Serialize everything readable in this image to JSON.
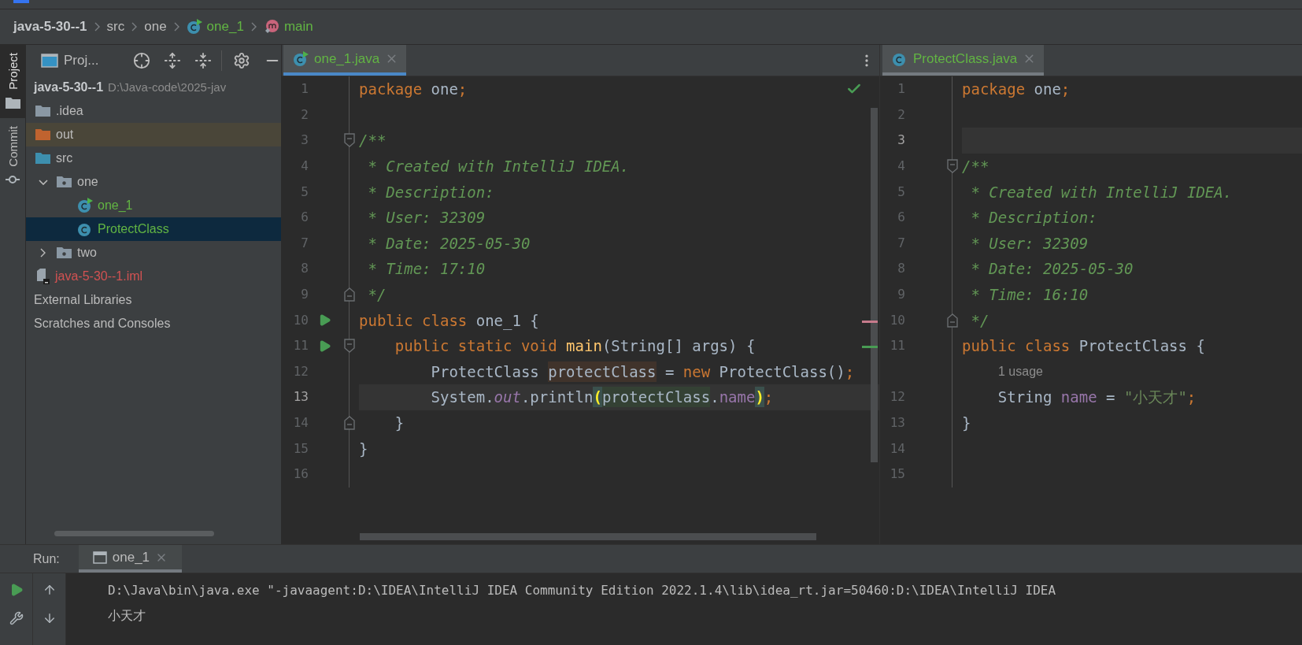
{
  "breadcrumb": [
    {
      "label": "java-5-30--1",
      "kind": "module"
    },
    {
      "label": "src",
      "kind": "folder"
    },
    {
      "label": "one",
      "kind": "folder"
    },
    {
      "label": "one_1",
      "kind": "runnable-class",
      "color": "#62b543"
    },
    {
      "label": "main",
      "kind": "method",
      "color": "#62b543"
    }
  ],
  "side_tabs": [
    {
      "label": "Project",
      "kind": "project",
      "selected": true
    },
    {
      "label": "Commit",
      "kind": "commit",
      "selected": false
    }
  ],
  "project_panel": {
    "title": "Proj...",
    "tree": [
      {
        "label": "java-5-30--1",
        "path": "D:\\Java-code\\2025-jav",
        "kind": "module",
        "selected": false,
        "children": [
          {
            "label": ".idea",
            "kind": "folder",
            "selected": false
          },
          {
            "label": "out",
            "kind": "excluded-folder",
            "selected": false
          },
          {
            "label": "src",
            "kind": "source-folder",
            "selected": false,
            "children": [
              {
                "label": "one",
                "kind": "package",
                "expanded": true,
                "selected": false,
                "children": [
                  {
                    "label": "one_1",
                    "kind": "runnable-class",
                    "color": "#62b543",
                    "selected": false
                  },
                  {
                    "label": "ProtectClass",
                    "kind": "class",
                    "color": "#62b543",
                    "selected": true
                  }
                ]
              },
              {
                "label": "two",
                "kind": "package",
                "expanded": false,
                "selected": false
              }
            ]
          },
          {
            "label": "java-5-30--1.iml",
            "kind": "module-file",
            "color": "#d25252",
            "selected": false
          }
        ]
      },
      {
        "label": "External Libraries",
        "kind": "libraries",
        "selected": false
      },
      {
        "label": "Scratches and Consoles",
        "kind": "scratches",
        "selected": false
      }
    ]
  },
  "editors": [
    {
      "tab": {
        "label": "one_1.java",
        "kind": "runnable-class",
        "color": "#62b543",
        "selected": true
      },
      "focused": true,
      "more_menu": true,
      "inspection_ok": true,
      "lines": [
        {
          "n": "1",
          "current": false,
          "tokens": [
            {
              "kind": "kw",
              "text": "package"
            },
            {
              "kind": "plain",
              "text": " one"
            },
            {
              "kind": "semi",
              "text": ";"
            }
          ]
        },
        {
          "n": "2",
          "current": false
        },
        {
          "n": "3",
          "current": false,
          "markers": [
            {
              "kind": "fold-start"
            }
          ],
          "tokens": [
            {
              "kind": "doc",
              "text": "/**"
            }
          ]
        },
        {
          "n": "4",
          "current": false,
          "tokens": [
            {
              "kind": "doc",
              "text": " * Created with IntelliJ IDEA."
            }
          ]
        },
        {
          "n": "5",
          "current": false,
          "tokens": [
            {
              "kind": "doc",
              "text": " * Description:"
            }
          ]
        },
        {
          "n": "6",
          "current": false,
          "tokens": [
            {
              "kind": "doc",
              "text": " * User: 32309"
            }
          ]
        },
        {
          "n": "7",
          "current": false,
          "tokens": [
            {
              "kind": "doc",
              "text": " * Date: 2025-05-30"
            }
          ]
        },
        {
          "n": "8",
          "current": false,
          "tokens": [
            {
              "kind": "doc",
              "text": " * Time: 17:10"
            }
          ]
        },
        {
          "n": "9",
          "current": false,
          "markers": [
            {
              "kind": "fold-end"
            }
          ],
          "tokens": [
            {
              "kind": "doc",
              "text": " */"
            }
          ]
        },
        {
          "n": "10",
          "current": false,
          "markers": [
            {
              "kind": "run"
            }
          ],
          "tokens": [
            {
              "kind": "kw",
              "text": "public class "
            },
            {
              "kind": "plain",
              "text": "one_1 {"
            }
          ]
        },
        {
          "n": "11",
          "current": false,
          "markers": [
            {
              "kind": "run"
            },
            {
              "kind": "fold-start"
            }
          ],
          "tokens": [
            {
              "kind": "kw",
              "text": "    public static void "
            },
            {
              "kind": "decl",
              "text": "main"
            },
            {
              "kind": "plain",
              "text": "(String[] args) {"
            }
          ]
        },
        {
          "n": "12",
          "current": false,
          "tokens": [
            {
              "kind": "plain",
              "text": "        ProtectClass "
            },
            {
              "kind": "plain",
              "text": "protectClass",
              "highlight": {
                "kind": "write"
              }
            },
            {
              "kind": "plain",
              "text": " = "
            },
            {
              "kind": "kw",
              "text": "new "
            },
            {
              "kind": "plain",
              "text": "ProtectClass()"
            },
            {
              "kind": "semi",
              "text": ";"
            }
          ]
        },
        {
          "n": "13",
          "current": true,
          "tokens": [
            {
              "kind": "plain",
              "text": "        System."
            },
            {
              "kind": "static",
              "text": "out"
            },
            {
              "kind": "plain",
              "text": ".println"
            },
            {
              "kind": "plain",
              "text": "(",
              "highlight": {
                "kind": "brace"
              }
            },
            {
              "kind": "plain",
              "text": "protectClass",
              "highlight": {
                "kind": "read"
              }
            },
            {
              "kind": "plain",
              "text": "."
            },
            {
              "kind": "field",
              "text": "name"
            },
            {
              "kind": "plain",
              "text": ")",
              "highlight": {
                "kind": "brace"
              }
            },
            {
              "kind": "semi",
              "text": ";"
            }
          ]
        },
        {
          "n": "14",
          "current": false,
          "markers": [
            {
              "kind": "fold-end"
            }
          ],
          "tokens": [
            {
              "kind": "plain",
              "text": "    }"
            }
          ]
        },
        {
          "n": "15",
          "current": false,
          "tokens": [
            {
              "kind": "plain",
              "text": "}"
            }
          ]
        },
        {
          "n": "16",
          "current": false
        }
      ]
    },
    {
      "tab": {
        "label": "ProtectClass.java",
        "kind": "class",
        "color": "#62b543",
        "selected": true
      },
      "focused": false,
      "lines": [
        {
          "n": "1",
          "current": false,
          "tokens": [
            {
              "kind": "kw",
              "text": "package"
            },
            {
              "kind": "plain",
              "text": " one"
            },
            {
              "kind": "semi",
              "text": ";"
            }
          ]
        },
        {
          "n": "2",
          "current": false
        },
        {
          "n": "3",
          "current": true
        },
        {
          "n": "4",
          "current": false,
          "markers": [
            {
              "kind": "fold-start"
            }
          ],
          "tokens": [
            {
              "kind": "doc",
              "text": "/**"
            }
          ]
        },
        {
          "n": "5",
          "current": false,
          "tokens": [
            {
              "kind": "doc",
              "text": " * Created with IntelliJ IDEA."
            }
          ]
        },
        {
          "n": "6",
          "current": false,
          "tokens": [
            {
              "kind": "doc",
              "text": " * Description:"
            }
          ]
        },
        {
          "n": "7",
          "current": false,
          "tokens": [
            {
              "kind": "doc",
              "text": " * User: 32309"
            }
          ]
        },
        {
          "n": "8",
          "current": false,
          "tokens": [
            {
              "kind": "doc",
              "text": " * Date: 2025-05-30"
            }
          ]
        },
        {
          "n": "9",
          "current": false,
          "tokens": [
            {
              "kind": "doc",
              "text": " * Time: 16:10"
            }
          ]
        },
        {
          "n": "10",
          "current": false,
          "markers": [
            {
              "kind": "fold-end"
            }
          ],
          "tokens": [
            {
              "kind": "doc",
              "text": " */"
            }
          ]
        },
        {
          "n": "11",
          "current": false,
          "tokens": [
            {
              "kind": "kw",
              "text": "public class "
            },
            {
              "kind": "plain",
              "text": "ProtectClass {"
            }
          ]
        },
        {
          "kind": "hint",
          "text": "1 usage"
        },
        {
          "n": "12",
          "current": false,
          "tokens": [
            {
              "kind": "plain",
              "text": "    String "
            },
            {
              "kind": "field",
              "text": "name"
            },
            {
              "kind": "plain",
              "text": " = "
            },
            {
              "kind": "str",
              "text": "\"小天才\""
            },
            {
              "kind": "semi",
              "text": ";"
            }
          ]
        },
        {
          "n": "13",
          "current": false,
          "tokens": [
            {
              "kind": "plain",
              "text": "}"
            }
          ]
        },
        {
          "n": "14",
          "current": false
        },
        {
          "n": "15",
          "current": false
        }
      ]
    }
  ],
  "run_panel": {
    "label": "Run:",
    "tab": {
      "label": "one_1",
      "selected": true
    },
    "console": [
      "D:\\Java\\bin\\java.exe \"-javaagent:D:\\IDEA\\IntelliJ IDEA Community Edition 2022.1.4\\lib\\idea_rt.jar=50460:D:\\IDEA\\IntelliJ IDEA",
      "小天才"
    ]
  }
}
